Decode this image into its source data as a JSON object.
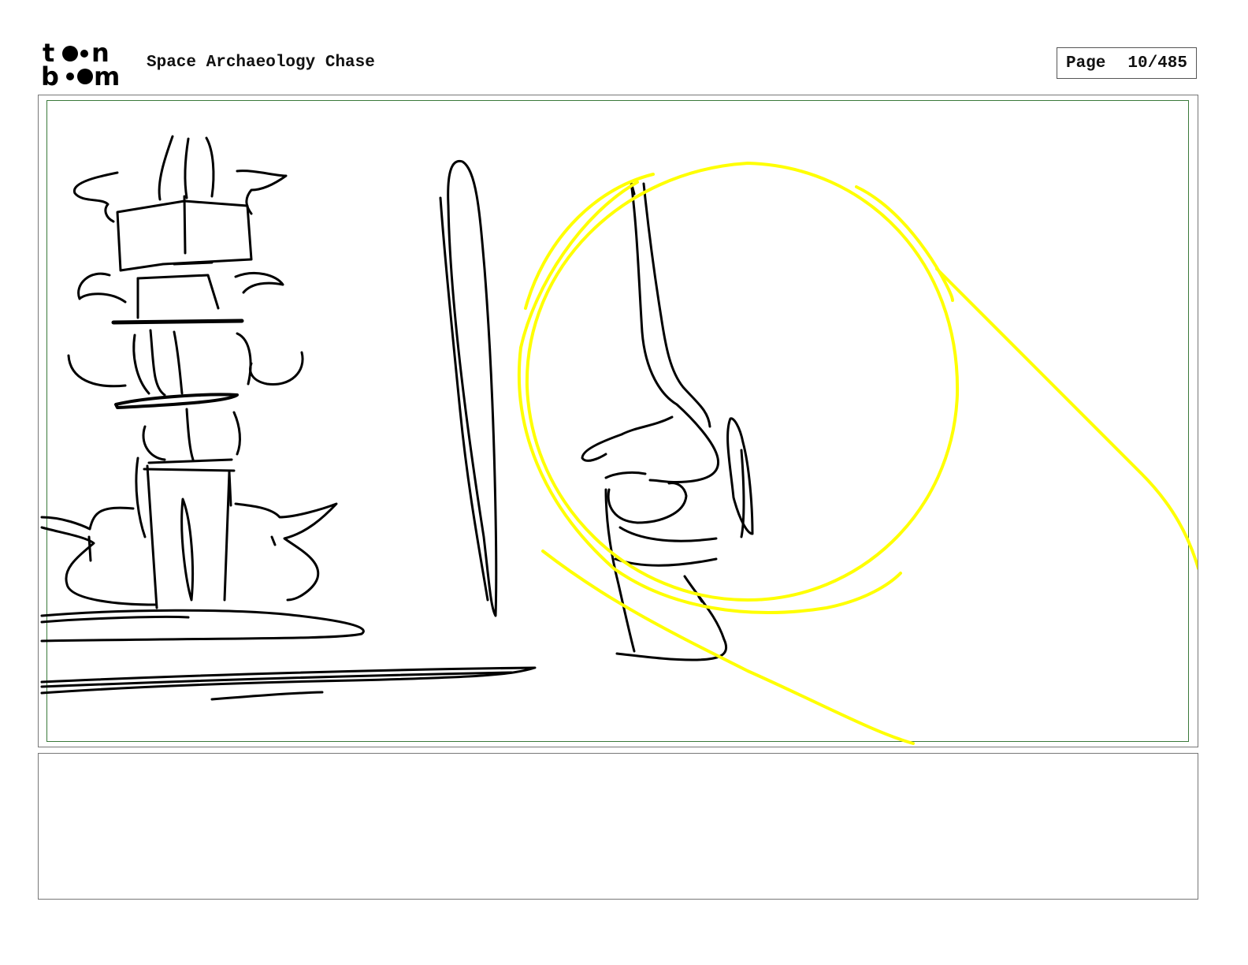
{
  "header": {
    "logo": {
      "line1": "toon",
      "line2": "boom"
    },
    "title": "Space Archaeology Chase",
    "page_label": "Page",
    "page_number": "10/485"
  },
  "panel": {
    "sketch_ink_color": "#000000",
    "overlay_color": "#ffff00",
    "safe_frame_color": "#3a7a3a"
  },
  "caption": {
    "text": ""
  }
}
